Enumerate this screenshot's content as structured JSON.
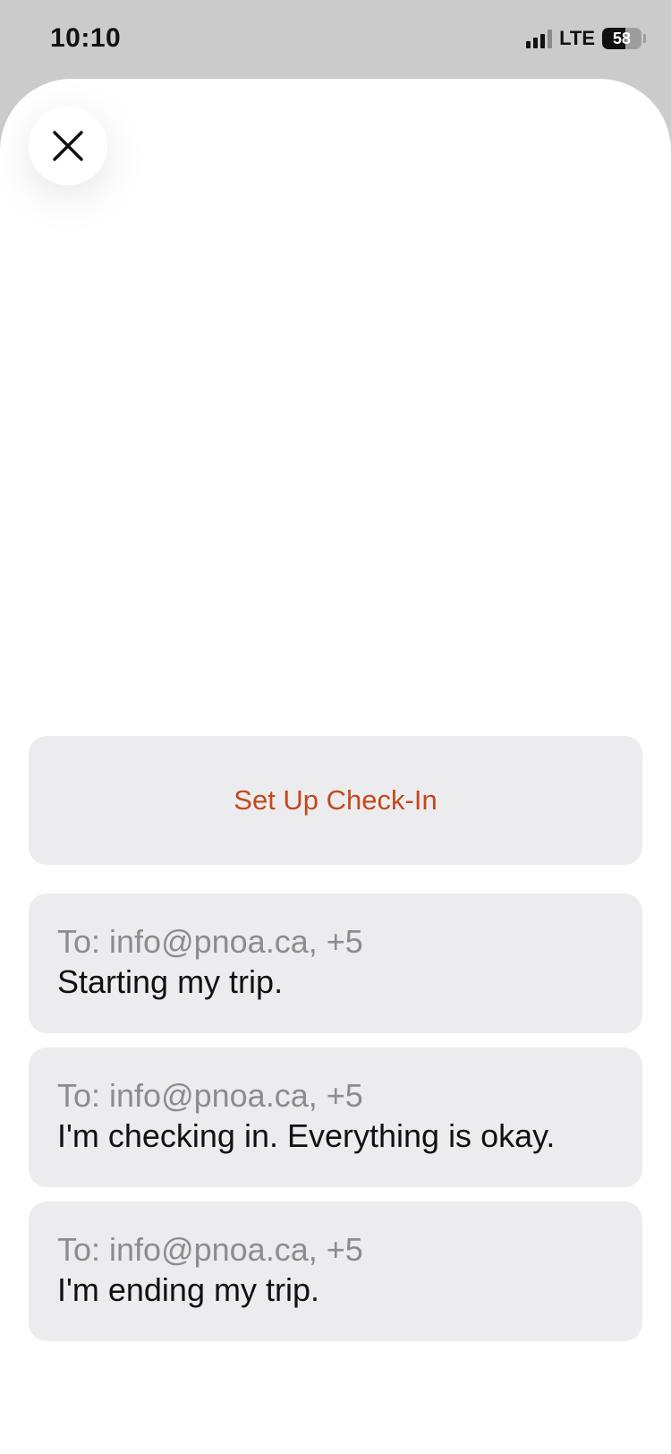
{
  "status_bar": {
    "time": "10:10",
    "network": "LTE",
    "battery_level": "58",
    "battery_fraction": 0.58,
    "signal_bars_active": 3,
    "signal_bars_total": 4
  },
  "sheet": {
    "close_icon": "close-icon",
    "setup_label": "Set Up Check-In",
    "accent_color": "#c2491e",
    "messages": [
      {
        "to": "To: info@pnoa.ca, +5",
        "body": "Starting my trip."
      },
      {
        "to": "To: info@pnoa.ca, +5",
        "body": "I'm checking in. Everything is okay."
      },
      {
        "to": "To: info@pnoa.ca, +5",
        "body": "I'm ending my trip."
      }
    ]
  }
}
